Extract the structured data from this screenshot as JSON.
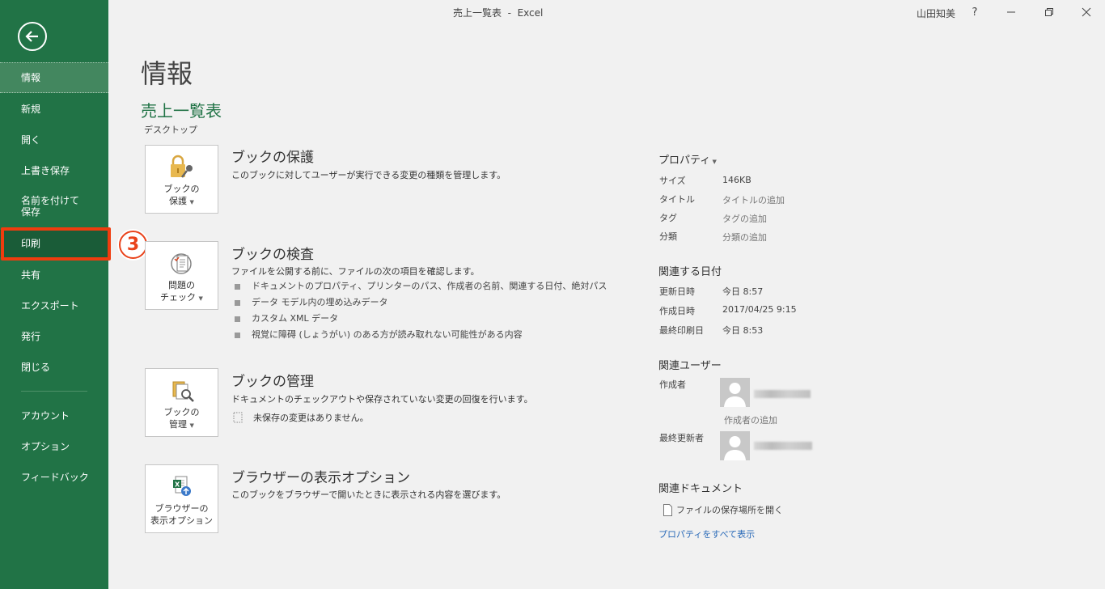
{
  "window": {
    "title": "売上一覧表  -  Excel",
    "user_name": "山田知美",
    "help": "?"
  },
  "sidebar": {
    "items": [
      {
        "label": "情報"
      },
      {
        "label": "新規"
      },
      {
        "label": "開く"
      },
      {
        "label": "上書き保存"
      },
      {
        "label": "名前を付けて\n保存"
      },
      {
        "label": "印刷"
      },
      {
        "label": "共有"
      },
      {
        "label": "エクスポート"
      },
      {
        "label": "発行"
      },
      {
        "label": "閉じる"
      },
      {
        "label": "アカウント"
      },
      {
        "label": "オプション"
      },
      {
        "label": "フィードバック"
      }
    ]
  },
  "annotation": {
    "step": "3"
  },
  "main": {
    "page_title": "情報",
    "doc_name": "売上一覧表",
    "doc_location": "デスクトップ",
    "sections": [
      {
        "button": "ブックの\n保護",
        "title": "ブックの保護",
        "desc": "このブックに対してユーザーが実行できる変更の種類を管理します。"
      },
      {
        "button": "問題の\nチェック",
        "title": "ブックの検査",
        "desc": "ファイルを公開する前に、ファイルの次の項目を確認します。",
        "bullets": [
          "ドキュメントのプロパティ、プリンターのパス、作成者の名前、関連する日付、絶対パス",
          "データ モデル内の埋め込みデータ",
          "カスタム XML データ",
          "視覚に障碍 (しょうがい) のある方が読み取れない可能性がある内容"
        ]
      },
      {
        "button": "ブックの\n管理",
        "title": "ブックの管理",
        "desc": "ドキュメントのチェックアウトや保存されていない変更の回復を行います。",
        "note": "未保存の変更はありません。"
      },
      {
        "button": "ブラウザーの\n表示オプション",
        "title": "ブラウザーの表示オプション",
        "desc": "このブックをブラウザーで開いたときに表示される内容を選びます。"
      }
    ]
  },
  "properties": {
    "heading": "プロパティ",
    "rows": [
      {
        "label": "サイズ",
        "value": "146KB"
      },
      {
        "label": "タイトル",
        "value": "タイトルの追加"
      },
      {
        "label": "タグ",
        "value": "タグの追加"
      },
      {
        "label": "分類",
        "value": "分類の追加"
      }
    ],
    "dates_heading": "関連する日付",
    "dates": [
      {
        "label": "更新日時",
        "value": "今日 8:57"
      },
      {
        "label": "作成日時",
        "value": "2017/04/25 9:15"
      },
      {
        "label": "最終印刷日",
        "value": "今日 8:53"
      }
    ],
    "users_heading": "関連ユーザー",
    "author_label": "作成者",
    "add_author": "作成者の追加",
    "modifier_label": "最終更新者",
    "docs_heading": "関連ドキュメント",
    "open_location": "ファイルの保存場所を開く",
    "show_all": "プロパティをすべて表示"
  }
}
